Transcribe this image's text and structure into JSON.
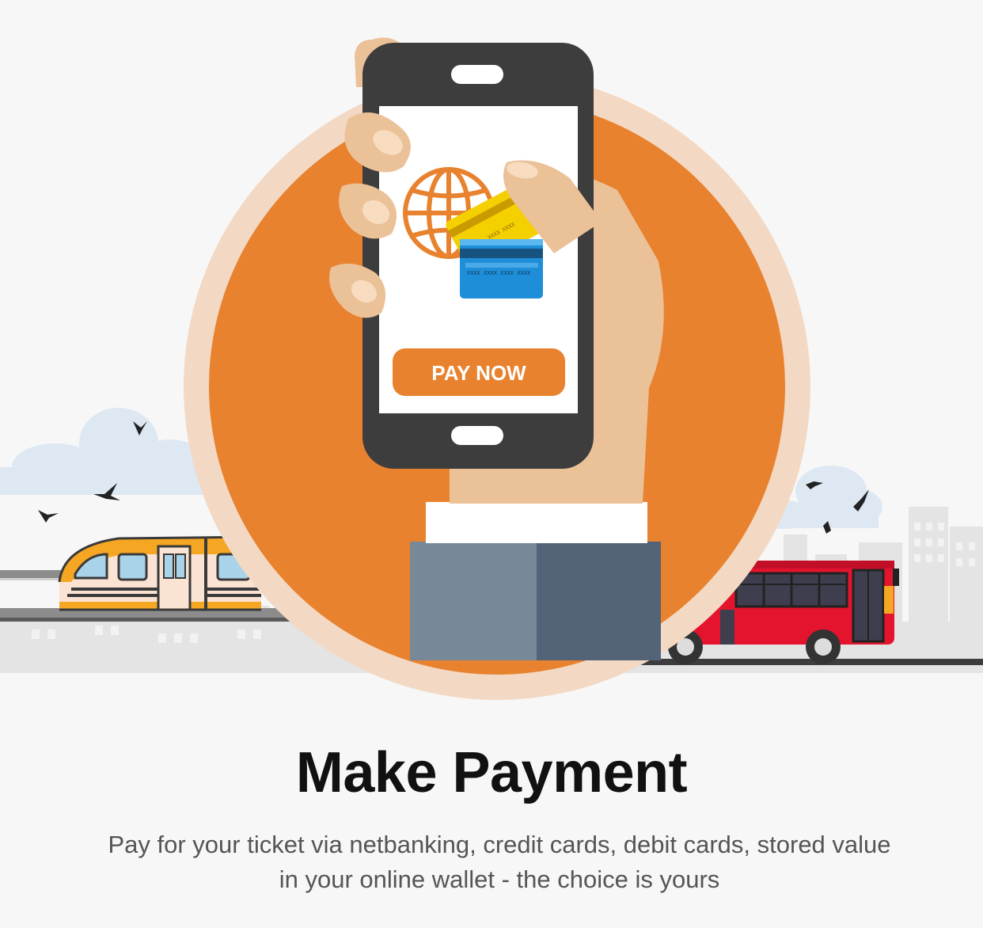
{
  "hero": {
    "pay_button_label": "PAY NOW",
    "card_gold_number": "XXXX XXXX",
    "card_blue_number": "XXXX XXXX XXXX XXXX"
  },
  "title": "Make Payment",
  "subtitle_line1": "Pay for your ticket via netbanking, credit cards, debit cards, stored value",
  "subtitle_line2": "in your online wallet - the choice is yours",
  "colors": {
    "background": "#f7f7f7",
    "accent_orange": "#e8822e",
    "halo": "#f3d9c4",
    "skin": "#ebc198",
    "phone": "#3d3d3d",
    "bus_red": "#e4142f",
    "train_orange": "#f5a623",
    "sleeve_light": "#788899",
    "sleeve_dark": "#536378"
  },
  "icons": [
    "globe-icon",
    "credit-card-icon",
    "bird-icon",
    "cloud-icon",
    "train-icon",
    "bus-icon"
  ]
}
